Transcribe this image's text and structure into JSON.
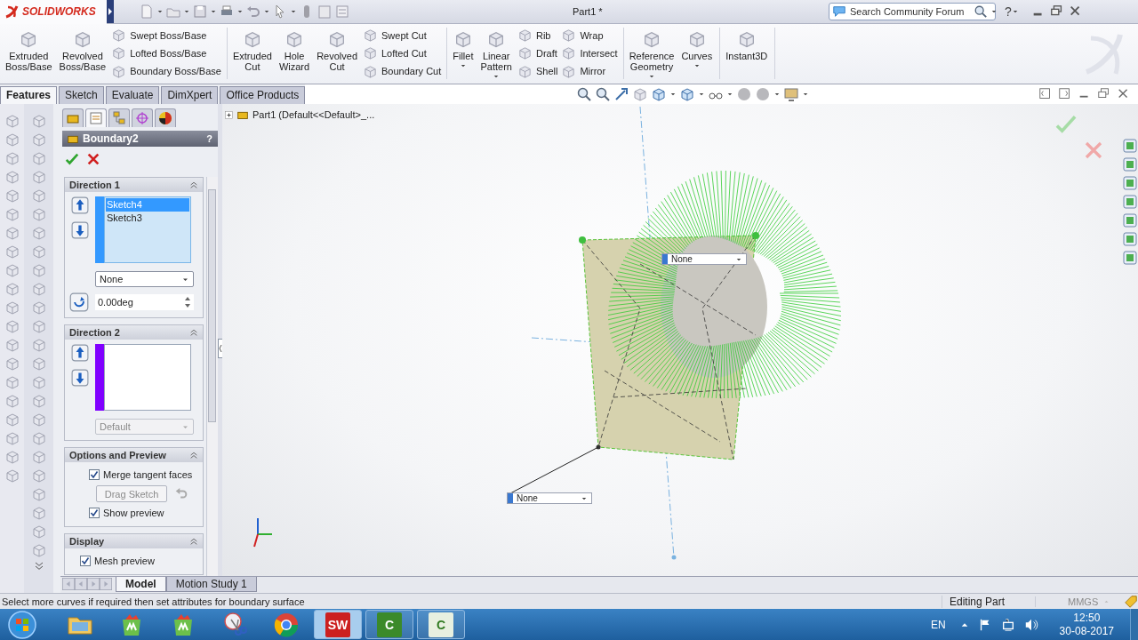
{
  "titlebar": {
    "logo": "SOLIDWORKS",
    "document_title": "Part1 *",
    "search": {
      "placeholder": "Search Community Forum"
    },
    "help": "?"
  },
  "ribbon": {
    "groups": [
      {
        "items": [
          {
            "kind": "large",
            "label": "Extruded Boss/Base",
            "dropdown": false
          },
          {
            "kind": "large",
            "label": "Revolved Boss/Base",
            "dropdown": false
          },
          {
            "kind": "stack",
            "labels": [
              "Swept Boss/Base",
              "Lofted Boss/Base",
              "Boundary Boss/Base"
            ]
          }
        ]
      },
      {
        "items": [
          {
            "kind": "large",
            "label": "Extruded Cut",
            "dropdown": false
          },
          {
            "kind": "large",
            "label": "Hole Wizard",
            "dropdown": false
          },
          {
            "kind": "large",
            "label": "Revolved Cut",
            "dropdown": false
          },
          {
            "kind": "stack",
            "labels": [
              "Swept Cut",
              "Lofted Cut",
              "Boundary Cut"
            ]
          }
        ]
      },
      {
        "items": [
          {
            "kind": "large",
            "label": "Fillet",
            "dropdown": true
          },
          {
            "kind": "large",
            "label": "Linear Pattern",
            "dropdown": true
          },
          {
            "kind": "stack",
            "labels": [
              "Rib",
              "Draft",
              "Shell"
            ]
          },
          {
            "kind": "stack",
            "labels": [
              "Wrap",
              "Intersect",
              "Mirror"
            ]
          }
        ]
      },
      {
        "items": [
          {
            "kind": "large",
            "label": "Reference Geometry",
            "dropdown": true
          },
          {
            "kind": "large",
            "label": "Curves",
            "dropdown": true
          }
        ]
      },
      {
        "items": [
          {
            "kind": "large",
            "label": "Instant3D",
            "dropdown": false
          }
        ]
      }
    ]
  },
  "tabs": [
    {
      "label": "Features",
      "selected": true
    },
    {
      "label": "Sketch",
      "selected": false
    },
    {
      "label": "Evaluate",
      "selected": false
    },
    {
      "label": "DimXpert",
      "selected": false
    },
    {
      "label": "Office Products",
      "selected": false
    }
  ],
  "property_manager": {
    "panel_tabs": [
      {
        "selected": false
      },
      {
        "selected": true
      },
      {
        "selected": false
      },
      {
        "selected": false
      },
      {
        "selected": false
      }
    ],
    "title": "Boundary2",
    "help": "?",
    "sections": [
      {
        "kind": "direction",
        "title": "Direction 1",
        "expanded": true,
        "color": "#3399ff",
        "curves": [
          {
            "label": "Sketch4",
            "selected": true
          },
          {
            "label": "Sketch3",
            "selected": false
          }
        ],
        "tangency": {
          "value": "None",
          "disabled": false
        },
        "angle": "0.00deg"
      },
      {
        "kind": "direction",
        "title": "Direction 2",
        "expanded": true,
        "color": "#8000ff",
        "tangency": {
          "value": "Default",
          "disabled": true
        }
      },
      {
        "kind": "options",
        "title": "Options and Preview",
        "expanded": true,
        "controls": [
          {
            "kind": "checkbox",
            "label": "Merge tangent faces",
            "checked": true
          },
          {
            "kind": "button",
            "label": "Drag Sketch",
            "disabled": true
          },
          {
            "kind": "checkbox",
            "label": "Show preview",
            "checked": true
          }
        ]
      },
      {
        "kind": "options",
        "title": "Display",
        "expanded": true,
        "controls": [
          {
            "kind": "checkbox",
            "label": "Mesh preview",
            "checked": true
          }
        ]
      }
    ]
  },
  "viewport": {
    "tree_item": "Part1  (Default<<Default>_...",
    "callouts": [
      {
        "value": "None"
      },
      {
        "value": "None"
      }
    ]
  },
  "bottom_tabs": [
    {
      "label": "Model",
      "selected": true
    },
    {
      "label": "Motion Study 1",
      "selected": false
    }
  ],
  "status_bar": {
    "message": "Select more curves if required then set attributes for boundary surface",
    "mode": "Editing Part",
    "units": "MMGS"
  },
  "taskbar": {
    "apps": [
      {
        "kind": "folder",
        "active": false,
        "running": false
      },
      {
        "kind": "bag",
        "active": false,
        "running": false
      },
      {
        "kind": "bag",
        "active": false,
        "running": false
      },
      {
        "kind": "scissors",
        "active": false,
        "running": false
      },
      {
        "kind": "ring",
        "active": false,
        "running": false
      },
      {
        "kind": "badge",
        "label": "SW",
        "color": "#cc2020",
        "active": true,
        "running": true
      },
      {
        "kind": "badge",
        "label": "C",
        "color": "#3b8a2a",
        "active": false,
        "running": true
      },
      {
        "kind": "badge",
        "label": "C",
        "color": "#e8f0e0",
        "active": false,
        "running": true
      }
    ],
    "language": "EN",
    "time": "12:50",
    "date": "30-08-2017"
  }
}
